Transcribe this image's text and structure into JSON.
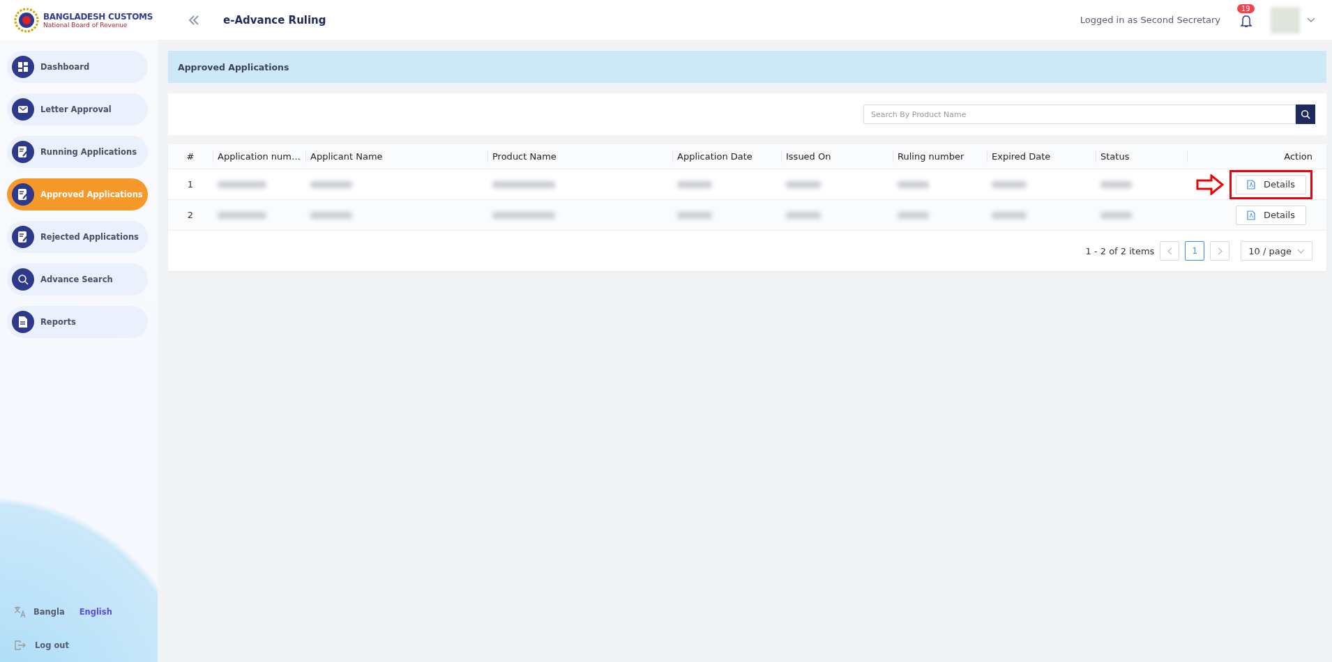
{
  "header": {
    "logo_title": "BANGLADESH CUSTOMS",
    "logo_subtitle": "National Board of Revenue",
    "app_title": "e-Advance Ruling",
    "logged_in": "Logged in as Second Secretary",
    "notifications": "19"
  },
  "sidebar": {
    "items": [
      {
        "label": "Dashboard",
        "kind": "grid",
        "selected": false
      },
      {
        "label": "Letter Approval",
        "kind": "mail",
        "selected": false
      },
      {
        "label": "Running Applications",
        "kind": "edit",
        "selected": false
      },
      {
        "label": "Approved Applications",
        "kind": "edit",
        "selected": true
      },
      {
        "label": "Rejected Applications",
        "kind": "edit",
        "selected": false
      },
      {
        "label": "Advance Search",
        "kind": "search",
        "selected": false
      },
      {
        "label": "Reports",
        "kind": "report",
        "selected": false
      }
    ],
    "languages": [
      {
        "label": "Bangla",
        "selected": false
      },
      {
        "label": "English",
        "selected": true
      }
    ],
    "logout": "Log out"
  },
  "page_title": "Approved Applications",
  "search": {
    "placeholder": "Search By Product Name"
  },
  "table": {
    "columns": [
      "#",
      "Application num…",
      "Applicant Name",
      "Product Name",
      "Application Date",
      "Issued On",
      "Ruling number",
      "Expired Date",
      "Status",
      "Action"
    ],
    "rows": [
      {
        "number": "1",
        "action": "Details",
        "annotated": true
      },
      {
        "number": "2",
        "action": "Details",
        "annotated": false
      }
    ]
  },
  "pagination": {
    "summary": "1 - 2 of 2 items",
    "pages": [
      {
        "label": "1",
        "selected": true
      }
    ],
    "page_size": "10 / page"
  }
}
